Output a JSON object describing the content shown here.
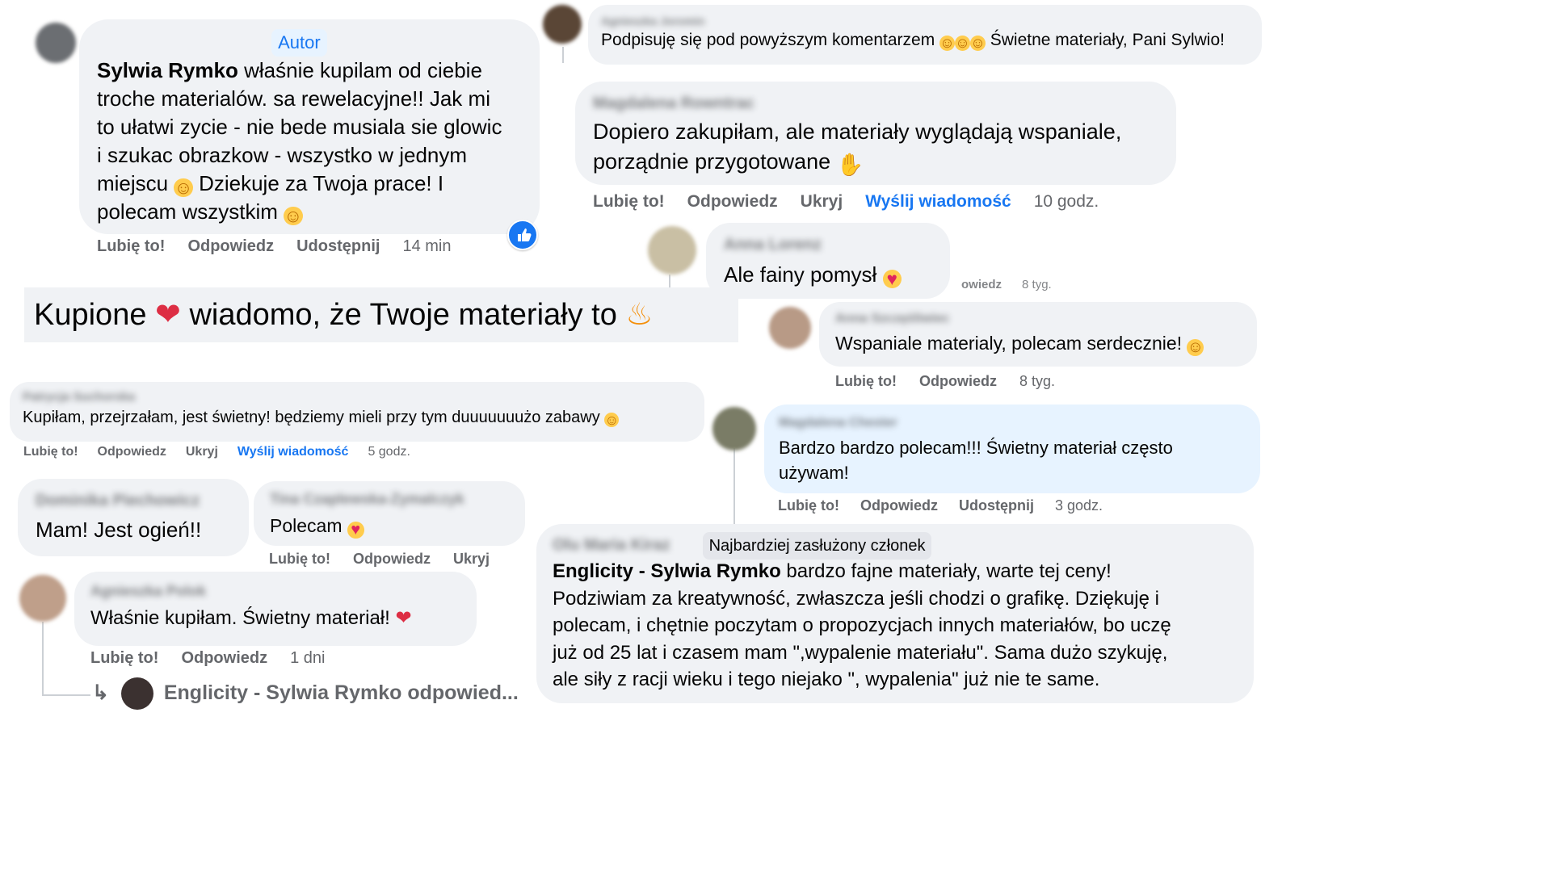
{
  "comment_author": {
    "badge": "Autor",
    "mention": "Sylwia Rymko",
    "text": "właśnie kupilam od ciebie troche materialów. sa rewelacyjne!! Jak mi to ułatwi zycie - nie bede musiala sie glowic i szukac obrazkow - wszystko w jednym miejscu 🙂 Dziekuje za Twoja prace! I polecam wszystkim 🙂",
    "text_lines": [
      "właśnie kupilam od ciebie",
      "troche materialów. sa rewelacyjne!! Jak mi",
      "to ułatwi zycie - nie bede musiala sie glowic",
      "i szukac obrazkow - wszystko w jednym",
      "miejscu",
      "Dziekuje za Twoja prace! I",
      "polecam wszystkim"
    ],
    "actions": [
      "Lubię to!",
      "Odpowiedz",
      "Udostępnij"
    ],
    "time": "14 min"
  },
  "comment_agnieszka": {
    "name": "Agnieszka Joromin",
    "text": "Podpisuję się pod powyższym komentarzem",
    "text_after": "Świetne materiały, Pani Sylwio!"
  },
  "comment_magdalena_r": {
    "name": "Magdalena Rowntrac",
    "line1": "Dopiero zakupiłam, ale materiały wyglądają wspaniale,",
    "line2": "porządnie przygotowane",
    "actions": [
      "Lubię to!",
      "Odpowiedz",
      "Ukryj"
    ],
    "message": "Wyślij wiadomość",
    "time": "10 godz."
  },
  "comment_anna_l": {
    "name": "Anna Lorenz",
    "text": "Ale fainy pomysł",
    "hidden_under_1": "owiedz",
    "hidden_under_2": "8 tyg."
  },
  "banner": {
    "part1": "Kupione",
    "part2": "wiadomo, że Twoje materiały to"
  },
  "comment_anna_s": {
    "name": "Anna Szczęśliwiec",
    "text": "Wspaniale materialy, polecam serdecznie!",
    "actions": [
      "Lubię to!",
      "Odpowiedz"
    ],
    "time": "8 tyg."
  },
  "comment_patrycja": {
    "name": "Patrycja Suchorska",
    "text": "Kupiłam, przejrzałam, jest świetny! będziemy mieli przy tym duuuuuuużo zabawy",
    "actions": [
      "Lubię to!",
      "Odpowiedz",
      "Ukryj"
    ],
    "message": "Wyślij wiadomość",
    "time": "5 godz."
  },
  "comment_magdalena_c": {
    "name": "Magdalena Chester",
    "line1": "Bardzo bardzo polecam!!! Świetny materiał często",
    "line2": "używam!",
    "actions": [
      "Lubię to!",
      "Odpowiedz",
      "Udostępnij"
    ],
    "time": "3 godz."
  },
  "comment_dominika": {
    "name": "Dominika Piechowicz",
    "text": "Mam! Jest ogień!!"
  },
  "comment_tina": {
    "name": "Tina Czaplewska-Zymalczyk",
    "text": "Polecam",
    "actions": [
      "Lubię to!",
      "Odpowiedz",
      "Ukryj"
    ]
  },
  "comment_agnieszka_p": {
    "name": "Agnieszka Polok",
    "text": "Właśnie kupiłam. Świetny materiał!",
    "actions": [
      "Lubię to!",
      "Odpowiedz"
    ],
    "time": "1 dni"
  },
  "reply_link": {
    "arrow": "↳",
    "text": "Englicity - Sylwia Rymko odpowied..."
  },
  "comment_top_member": {
    "name": "Olu Maria Kiraz",
    "badge": "Najbardziej zasłużony członek",
    "mention": "Englicity - Sylwia Rymko",
    "line1": "bardzo fajne materiały, warte tej ceny!",
    "line2": "Podziwiam za kreatywność, zwłaszcza jeśli chodzi o grafikę. Dziękuję i",
    "line3": "polecam, i chętnie poczytam o propozycjach innych materiałów, bo uczę",
    "line4": "już od 25 lat i czasem mam \",wypalenie materiału\". Sama dużo szykuję,",
    "line5": "ale siły z racji wieku i tego niejako \", wypalenia\" już nie te same."
  },
  "colors": {
    "bubble": "#f0f2f5",
    "bubble_highlight": "#e7f3ff",
    "link_blue": "#1877f2",
    "meta_gray": "#65676b",
    "like_blue": "#1877f2"
  },
  "icons": {
    "smile": "slightly-smiling-face-icon",
    "heart_eyes": "smiling-face-with-heart-eyes-icon",
    "heart": "red-heart-icon",
    "fire": "fire-icon",
    "clap": "clapping-hands-icon",
    "like": "like-thumb-icon",
    "reply_arrow": "reply-arrow-icon"
  }
}
